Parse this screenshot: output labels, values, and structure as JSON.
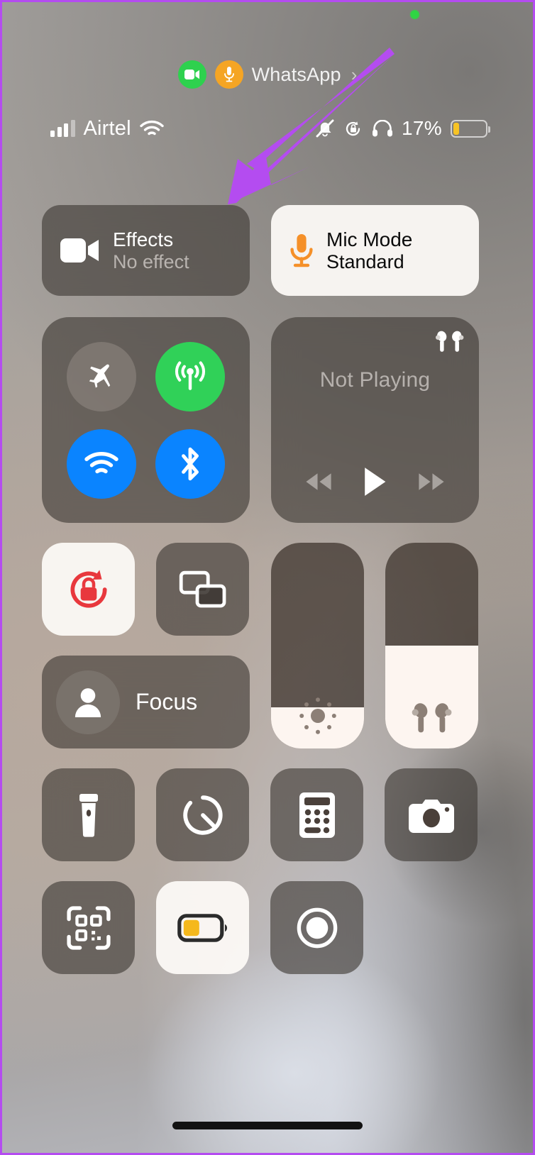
{
  "status_bar": {
    "carrier": "Airtel",
    "wifi_icon": "wifi-icon",
    "signal_icon": "cellular-signal-icon",
    "silent_icon": "bell-slash-icon",
    "rotation_lock_icon": "rotation-lock-icon",
    "headphones_icon": "headphones-icon",
    "battery_percent": "17%",
    "battery_level": 17,
    "privacy_indicator": "green-camera-privacy-dot"
  },
  "call_banner": {
    "app_name": "WhatsApp",
    "camera_badge_icon": "video-camera-icon",
    "mic_badge_icon": "microphone-icon",
    "chevron_icon": "chevron-right-icon",
    "camera_badge_color": "#2ed14e",
    "mic_badge_color": "#f5a524"
  },
  "control_center": {
    "effects": {
      "title": "Effects",
      "subtitle": "No effect",
      "icon": "video-camera-icon",
      "active": false
    },
    "mic_mode": {
      "title": "Mic Mode",
      "subtitle": "Standard",
      "icon": "microphone-icon",
      "icon_color": "#f59029",
      "active": true
    },
    "connectivity": {
      "airplane": {
        "label": "Airplane Mode",
        "icon": "airplane-icon",
        "state": "off"
      },
      "cellular": {
        "label": "Cellular Data",
        "icon": "cellular-antenna-icon",
        "state": "on"
      },
      "wifi": {
        "label": "Wi-Fi",
        "icon": "wifi-icon",
        "state": "on"
      },
      "bluetooth": {
        "label": "Bluetooth",
        "icon": "bluetooth-icon",
        "state": "on"
      }
    },
    "media": {
      "title": "Not Playing",
      "route_icon": "airpods-icon",
      "rewind_icon": "rewind-icon",
      "play_icon": "play-icon",
      "forward_icon": "fast-forward-icon"
    },
    "rotation_lock": {
      "label": "Rotation Lock",
      "icon": "rotation-lock-icon",
      "active": true,
      "icon_color": "#e8383d"
    },
    "screen_mirroring": {
      "label": "Screen Mirroring",
      "icon": "screen-mirroring-icon",
      "active": false
    },
    "focus": {
      "label": "Focus",
      "icon": "person-icon",
      "active": false
    },
    "brightness": {
      "label": "Brightness",
      "icon": "brightness-icon",
      "value": 20
    },
    "volume": {
      "label": "Volume",
      "icon": "airpods-icon",
      "value": 50
    },
    "shortcuts": [
      {
        "label": "Flashlight",
        "icon": "flashlight-icon",
        "active": false
      },
      {
        "label": "Timer",
        "icon": "timer-icon",
        "active": false
      },
      {
        "label": "Calculator",
        "icon": "calculator-icon",
        "active": false
      },
      {
        "label": "Camera",
        "icon": "camera-icon",
        "active": false
      },
      {
        "label": "Code Scanner",
        "icon": "qr-code-icon",
        "active": false
      },
      {
        "label": "Low Power Mode",
        "icon": "battery-icon",
        "active": true
      },
      {
        "label": "Screen Recording",
        "icon": "screen-record-icon",
        "active": false
      }
    ]
  },
  "annotation": {
    "arrow_color": "#b44cf0",
    "border_color": "#b44cf0",
    "points_to": "Effects"
  },
  "home_indicator": "home-indicator-bar"
}
